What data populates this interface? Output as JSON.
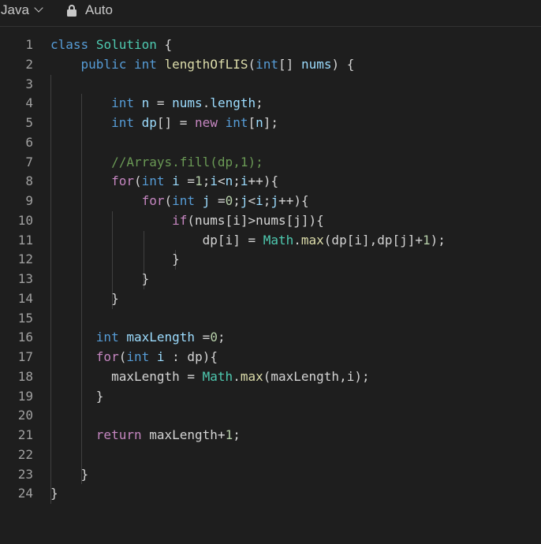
{
  "toolbar": {
    "language": "Java",
    "mode_label": "Auto",
    "icons": [
      "chevron-down-icon",
      "lock-icon"
    ]
  },
  "colors": {
    "background": "#1e1e1e",
    "line_number": "#a0a0a0",
    "plain": "#d4d4d4",
    "keyword": "#569cd6",
    "control": "#c586c0",
    "type": "#4ec9b0",
    "function": "#dcdcaa",
    "variable": "#9cdcfe",
    "number": "#b5cea8",
    "comment": "#6a9955"
  },
  "code": {
    "lines": [
      {
        "num": "1",
        "tokens": [
          [
            "class",
            "kw"
          ],
          [
            " ",
            "plain"
          ],
          [
            "Solution",
            "type"
          ],
          [
            " {",
            "plain"
          ]
        ]
      },
      {
        "num": "2",
        "tokens": [
          [
            "    ",
            "plain"
          ],
          [
            "public",
            "kw"
          ],
          [
            " ",
            "plain"
          ],
          [
            "int",
            "kw"
          ],
          [
            " ",
            "plain"
          ],
          [
            "lengthOfLIS",
            "fn"
          ],
          [
            "(",
            "plain"
          ],
          [
            "int",
            "kw"
          ],
          [
            "[] ",
            "plain"
          ],
          [
            "nums",
            "var"
          ],
          [
            ") {",
            "plain"
          ]
        ]
      },
      {
        "num": "3",
        "tokens": []
      },
      {
        "num": "4",
        "tokens": [
          [
            "        ",
            "plain"
          ],
          [
            "int",
            "kw"
          ],
          [
            " ",
            "plain"
          ],
          [
            "n",
            "var"
          ],
          [
            " = ",
            "plain"
          ],
          [
            "nums",
            "var"
          ],
          [
            ".",
            "plain"
          ],
          [
            "length",
            "var"
          ],
          [
            ";",
            "plain"
          ]
        ]
      },
      {
        "num": "5",
        "tokens": [
          [
            "        ",
            "plain"
          ],
          [
            "int",
            "kw"
          ],
          [
            " ",
            "plain"
          ],
          [
            "dp",
            "var"
          ],
          [
            "[] = ",
            "plain"
          ],
          [
            "new",
            "ctrl"
          ],
          [
            " ",
            "plain"
          ],
          [
            "int",
            "kw"
          ],
          [
            "[",
            "plain"
          ],
          [
            "n",
            "var"
          ],
          [
            "];",
            "plain"
          ]
        ]
      },
      {
        "num": "6",
        "tokens": []
      },
      {
        "num": "7",
        "tokens": [
          [
            "        ",
            "plain"
          ],
          [
            "//Arrays.fill(dp,1);",
            "cmt"
          ]
        ]
      },
      {
        "num": "8",
        "tokens": [
          [
            "        ",
            "plain"
          ],
          [
            "for",
            "ctrl"
          ],
          [
            "(",
            "plain"
          ],
          [
            "int",
            "kw"
          ],
          [
            " ",
            "plain"
          ],
          [
            "i",
            "var"
          ],
          [
            " =",
            "plain"
          ],
          [
            "1",
            "num"
          ],
          [
            ";",
            "plain"
          ],
          [
            "i",
            "var"
          ],
          [
            "<",
            "plain"
          ],
          [
            "n",
            "var"
          ],
          [
            ";",
            "plain"
          ],
          [
            "i",
            "var"
          ],
          [
            "++){",
            "plain"
          ]
        ]
      },
      {
        "num": "9",
        "tokens": [
          [
            "            ",
            "plain"
          ],
          [
            "for",
            "ctrl"
          ],
          [
            "(",
            "plain"
          ],
          [
            "int",
            "kw"
          ],
          [
            " ",
            "plain"
          ],
          [
            "j",
            "var"
          ],
          [
            " =",
            "plain"
          ],
          [
            "0",
            "num"
          ],
          [
            ";",
            "plain"
          ],
          [
            "j",
            "var"
          ],
          [
            "<",
            "plain"
          ],
          [
            "i",
            "var"
          ],
          [
            ";",
            "plain"
          ],
          [
            "j",
            "var"
          ],
          [
            "++){",
            "plain"
          ]
        ]
      },
      {
        "num": "10",
        "tokens": [
          [
            "                ",
            "plain"
          ],
          [
            "if",
            "ctrl"
          ],
          [
            "(nums[i]>nums[j]){",
            "plain"
          ]
        ]
      },
      {
        "num": "11",
        "tokens": [
          [
            "                    ",
            "plain"
          ],
          [
            "dp[i] = ",
            "plain"
          ],
          [
            "Math",
            "type"
          ],
          [
            ".",
            "plain"
          ],
          [
            "max",
            "fn"
          ],
          [
            "(dp[i],dp[j]+",
            "plain"
          ],
          [
            "1",
            "num"
          ],
          [
            ");",
            "plain"
          ]
        ]
      },
      {
        "num": "12",
        "tokens": [
          [
            "                ",
            "plain"
          ],
          [
            "}",
            "plain"
          ]
        ]
      },
      {
        "num": "13",
        "tokens": [
          [
            "            ",
            "plain"
          ],
          [
            "}",
            "plain"
          ]
        ]
      },
      {
        "num": "14",
        "tokens": [
          [
            "        ",
            "plain"
          ],
          [
            "}",
            "plain"
          ]
        ]
      },
      {
        "num": "15",
        "tokens": []
      },
      {
        "num": "16",
        "tokens": [
          [
            "      ",
            "plain"
          ],
          [
            "int",
            "kw"
          ],
          [
            " ",
            "plain"
          ],
          [
            "maxLength",
            "var"
          ],
          [
            " =",
            "plain"
          ],
          [
            "0",
            "num"
          ],
          [
            ";",
            "plain"
          ]
        ]
      },
      {
        "num": "17",
        "tokens": [
          [
            "      ",
            "plain"
          ],
          [
            "for",
            "ctrl"
          ],
          [
            "(",
            "plain"
          ],
          [
            "int",
            "kw"
          ],
          [
            " ",
            "plain"
          ],
          [
            "i",
            "var"
          ],
          [
            " : dp){",
            "plain"
          ]
        ]
      },
      {
        "num": "18",
        "tokens": [
          [
            "        ",
            "plain"
          ],
          [
            "maxLength = ",
            "plain"
          ],
          [
            "Math",
            "type"
          ],
          [
            ".",
            "plain"
          ],
          [
            "max",
            "fn"
          ],
          [
            "(maxLength,i);",
            "plain"
          ]
        ]
      },
      {
        "num": "19",
        "tokens": [
          [
            "      ",
            "plain"
          ],
          [
            "}",
            "plain"
          ]
        ]
      },
      {
        "num": "20",
        "tokens": []
      },
      {
        "num": "21",
        "tokens": [
          [
            "      ",
            "plain"
          ],
          [
            "return",
            "ctrl"
          ],
          [
            " maxLength+",
            "plain"
          ],
          [
            "1",
            "num"
          ],
          [
            ";",
            "plain"
          ]
        ]
      },
      {
        "num": "22",
        "tokens": []
      },
      {
        "num": "23",
        "tokens": [
          [
            "    ",
            "plain"
          ],
          [
            "}",
            "plain"
          ]
        ]
      },
      {
        "num": "24",
        "tokens": [
          [
            "}",
            "plain"
          ]
        ]
      }
    ]
  }
}
